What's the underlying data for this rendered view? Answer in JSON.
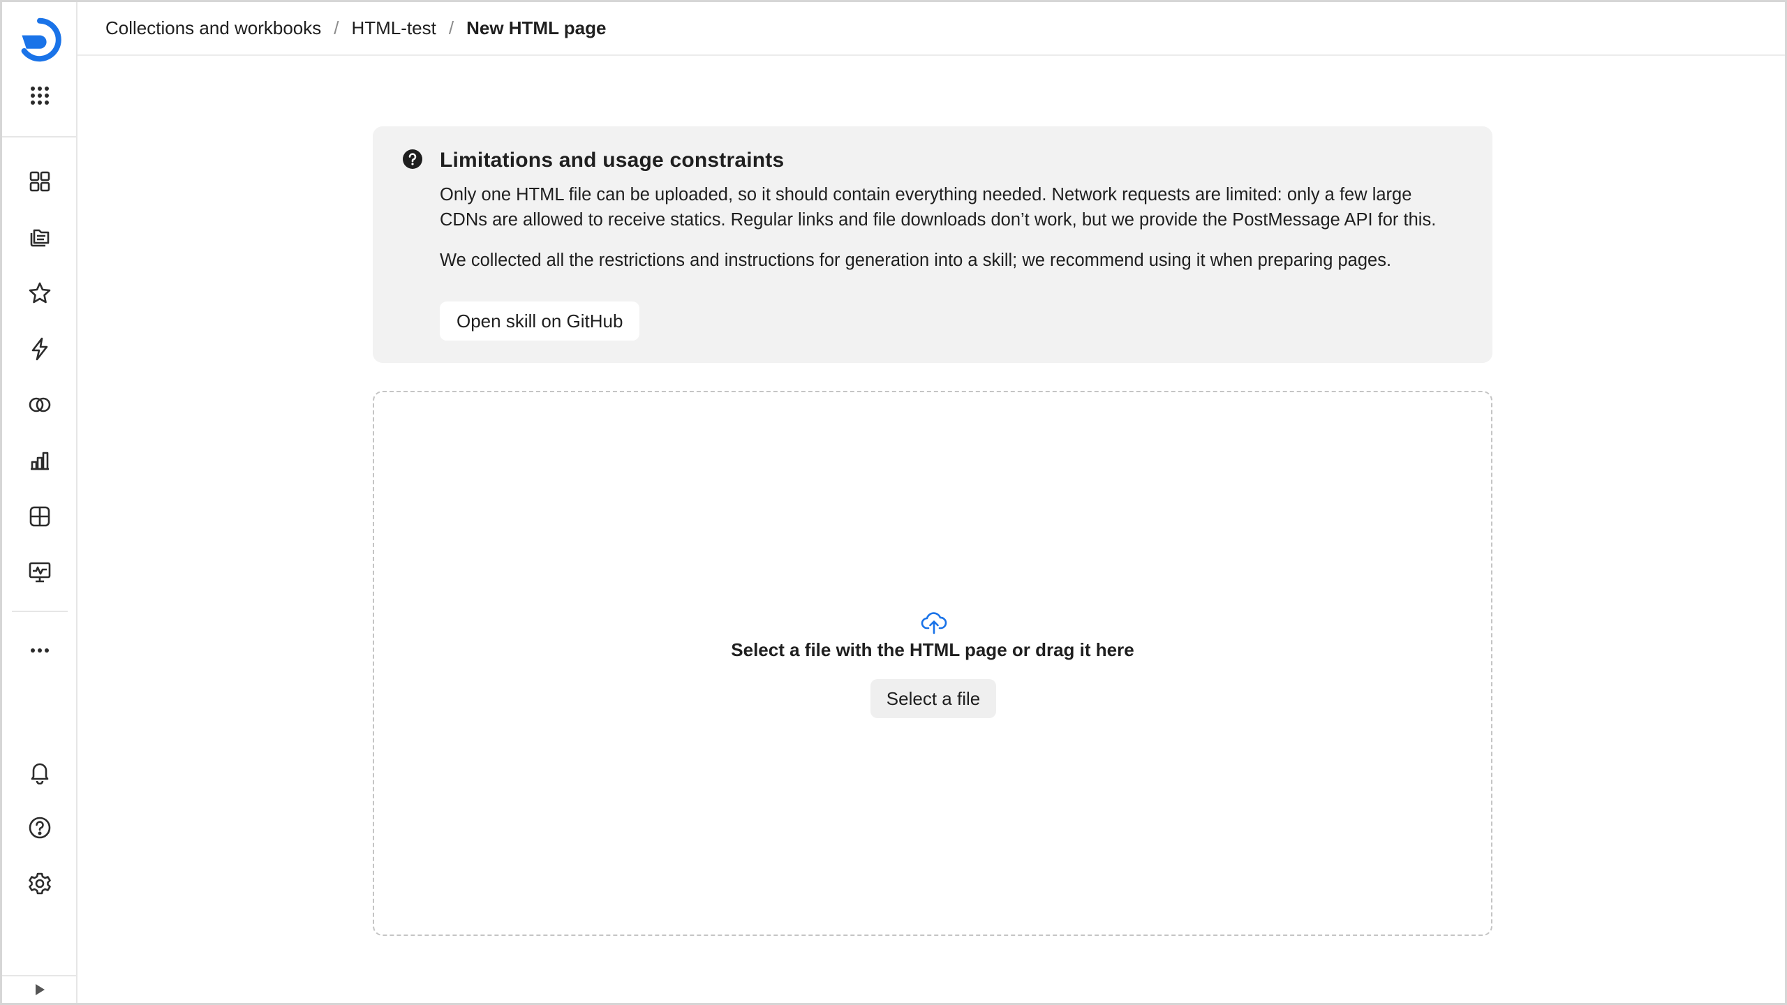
{
  "sidebar": {
    "logo_icon": "datalens-logo-icon",
    "items": [
      {
        "name": "apps-grid-icon"
      },
      {
        "name": "dashboard-tiles-icon"
      },
      {
        "name": "collections-icon"
      },
      {
        "name": "favorites-star-icon"
      },
      {
        "name": "lightning-icon"
      },
      {
        "name": "connections-icon"
      },
      {
        "name": "charts-icon"
      },
      {
        "name": "datasets-icon"
      },
      {
        "name": "monitoring-icon"
      },
      {
        "name": "more-icon"
      },
      {
        "name": "bell-icon"
      },
      {
        "name": "help-icon"
      },
      {
        "name": "gear-icon"
      },
      {
        "name": "collapse-triangle-icon"
      }
    ],
    "accent_color": "#1a73e8"
  },
  "breadcrumbs": {
    "items": [
      "Collections and workbooks",
      "HTML-test",
      "New HTML page"
    ],
    "separator": "/"
  },
  "info": {
    "icon": "question-circle-icon",
    "title": "Limitations and usage constraints",
    "paragraph1": "Only one HTML file can be uploaded, so it should contain everything needed. Network requests are limited: only a few large CDNs are allowed to receive statics. Regular links and file downloads don’t work, but we provide the PostMessage API for this.",
    "paragraph2": "We collected all the restrictions and instructions for generation into a skill; we recommend using it when preparing pages.",
    "button_label": "Open skill on GitHub"
  },
  "upload": {
    "icon": "cloud-upload-icon",
    "prompt": "Select a file with the HTML page or drag it here",
    "button_label": "Select a file",
    "icon_color": "#1a73e8"
  }
}
